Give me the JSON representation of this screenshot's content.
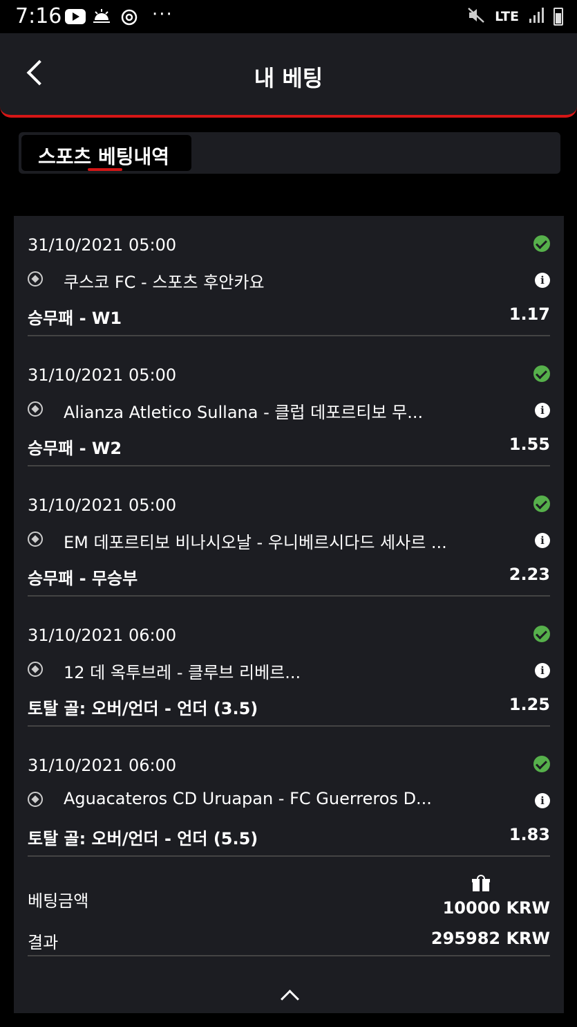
{
  "status_bar": {
    "time": "7:16",
    "network": "LTE",
    "icons": [
      "youtube-icon",
      "weather-icon",
      "sync-icon",
      "more-icon",
      "mute-icon",
      "signal-icon",
      "battery-icon"
    ]
  },
  "header": {
    "title": "내 베팅"
  },
  "tabs": [
    {
      "label": "스포츠 베팅내역",
      "active": true
    }
  ],
  "bets": [
    {
      "datetime": "31/10/2021 05:00",
      "match": "쿠스코 FC - 스포츠 후안카요",
      "market": "승무패 - W1",
      "odds": "1.17",
      "status": "won"
    },
    {
      "datetime": "31/10/2021 05:00",
      "match": "Alianza Atletico Sullana - 클럽 데포르티보 무...",
      "market": "승무패 - W2",
      "odds": "1.55",
      "status": "won"
    },
    {
      "datetime": "31/10/2021 05:00",
      "match": "EM 데포르티보 비나시오날 - 우니베르시다드 세사르 ...",
      "market": "승무패 - 무승부",
      "odds": "2.23",
      "status": "won"
    },
    {
      "datetime": "31/10/2021 06:00",
      "match": "12 데 옥투브레 - 클루브 리베르...",
      "market": "토탈 골: 오버/언더 - 언더 (3.5)",
      "odds": "1.25",
      "status": "won"
    },
    {
      "datetime": "31/10/2021 06:00",
      "match": "Aguacateros CD Uruapan - FC Guerreros D...",
      "market": "토탈 골: 오버/언더 - 언더 (5.5)",
      "odds": "1.83",
      "status": "won"
    }
  ],
  "summary": {
    "stake_label": "베팅금액",
    "stake_amount": "10000 KRW",
    "result_label": "결과",
    "result_amount": "295982 KRW"
  },
  "colors": {
    "accent": "#d51616",
    "success": "#56b04b",
    "panel": "#1c1d22",
    "background": "#000000"
  }
}
